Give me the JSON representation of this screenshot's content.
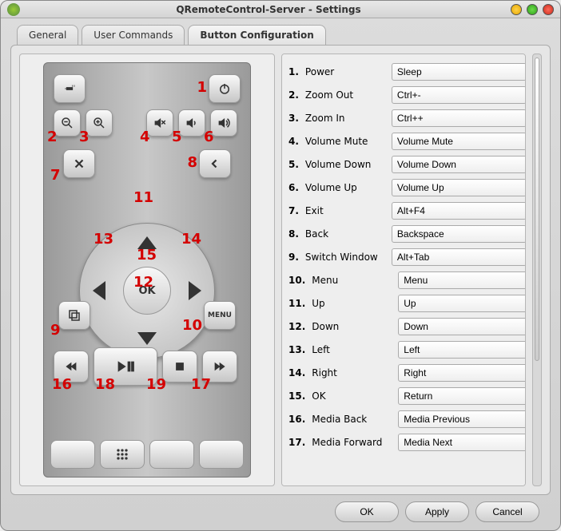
{
  "window": {
    "title": "QRemoteControl-Server - Settings"
  },
  "tabs": {
    "general": "General",
    "user": "User Commands",
    "button": "Button Configuration"
  },
  "remote": {
    "ok": "OK",
    "menu": "MENU"
  },
  "labels": [
    "1",
    "2",
    "3",
    "4",
    "5",
    "6",
    "7",
    "8",
    "9",
    "10",
    "11",
    "12",
    "13",
    "14",
    "15",
    "16",
    "17",
    "18",
    "19"
  ],
  "mappings": [
    {
      "n": "1.",
      "name": "Power",
      "value": "Sleep"
    },
    {
      "n": "2.",
      "name": "Zoom Out",
      "value": "Ctrl+-"
    },
    {
      "n": "3.",
      "name": "Zoom In",
      "value": "Ctrl++"
    },
    {
      "n": "4.",
      "name": "Volume Mute",
      "value": "Volume Mute"
    },
    {
      "n": "5.",
      "name": "Volume Down",
      "value": "Volume Down"
    },
    {
      "n": "6.",
      "name": "Volume Up",
      "value": "Volume Up"
    },
    {
      "n": "7.",
      "name": "Exit",
      "value": "Alt+F4"
    },
    {
      "n": "8.",
      "name": "Back",
      "value": "Backspace"
    },
    {
      "n": "9.",
      "name": "Switch Window",
      "value": "Alt+Tab"
    },
    {
      "n": "10.",
      "name": "Menu",
      "value": "Menu"
    },
    {
      "n": "11.",
      "name": "Up",
      "value": "Up"
    },
    {
      "n": "12.",
      "name": "Down",
      "value": "Down"
    },
    {
      "n": "13.",
      "name": "Left",
      "value": "Left"
    },
    {
      "n": "14.",
      "name": "Right",
      "value": "Right"
    },
    {
      "n": "15.",
      "name": "OK",
      "value": "Return"
    },
    {
      "n": "16.",
      "name": "Media Back",
      "value": "Media Previous"
    },
    {
      "n": "17.",
      "name": "Media Forward",
      "value": "Media Next"
    }
  ],
  "footer": {
    "ok": "OK",
    "apply": "Apply",
    "cancel": "Cancel"
  }
}
